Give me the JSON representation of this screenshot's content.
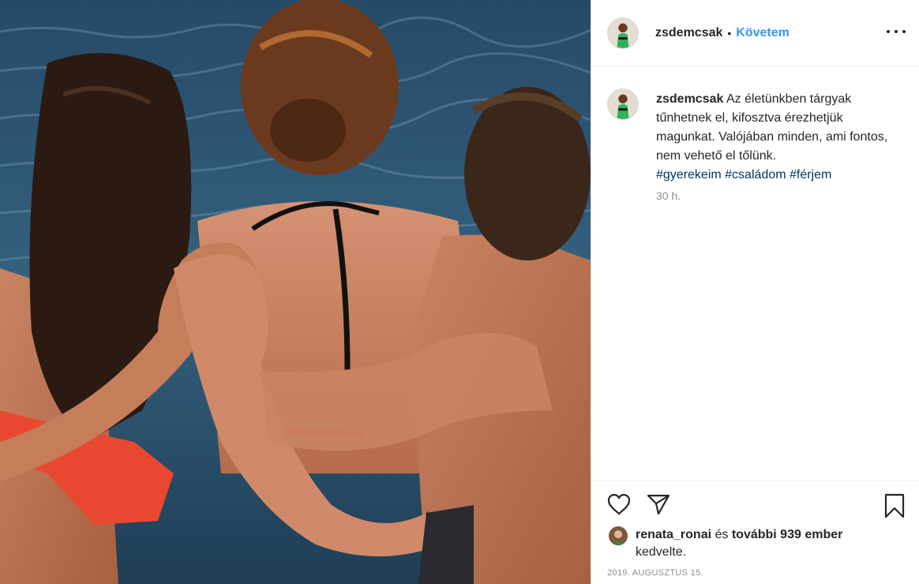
{
  "post": {
    "username": "zsdemcsak",
    "separator": "•",
    "follow_label": "Követem",
    "more_icon": "more-horizontal-icon",
    "caption": {
      "username": "zsdemcsak",
      "text": "Az életünkben tárgyak tűnhetnek el, kifosztva érezhetjük magunkat. Valójában minden, ami fontos, nem vehető el tőlünk.",
      "hashtags": [
        "#gyerekeim",
        "#családom",
        "#férjem"
      ]
    },
    "time_ago": "30 h.",
    "actions": {
      "like_icon": "heart-icon",
      "share_icon": "paper-plane-icon",
      "save_icon": "bookmark-icon"
    },
    "likes": {
      "first_user": "renata_ronai",
      "connector": " és ",
      "others": "további 939 ember",
      "suffix": "kedvelte."
    },
    "date": "2019. AUGUSZTUS 15.",
    "colors": {
      "link_blue": "#3897f0",
      "hashtag_blue": "#003569",
      "muted": "#8e8e8e",
      "text": "#262626"
    }
  }
}
